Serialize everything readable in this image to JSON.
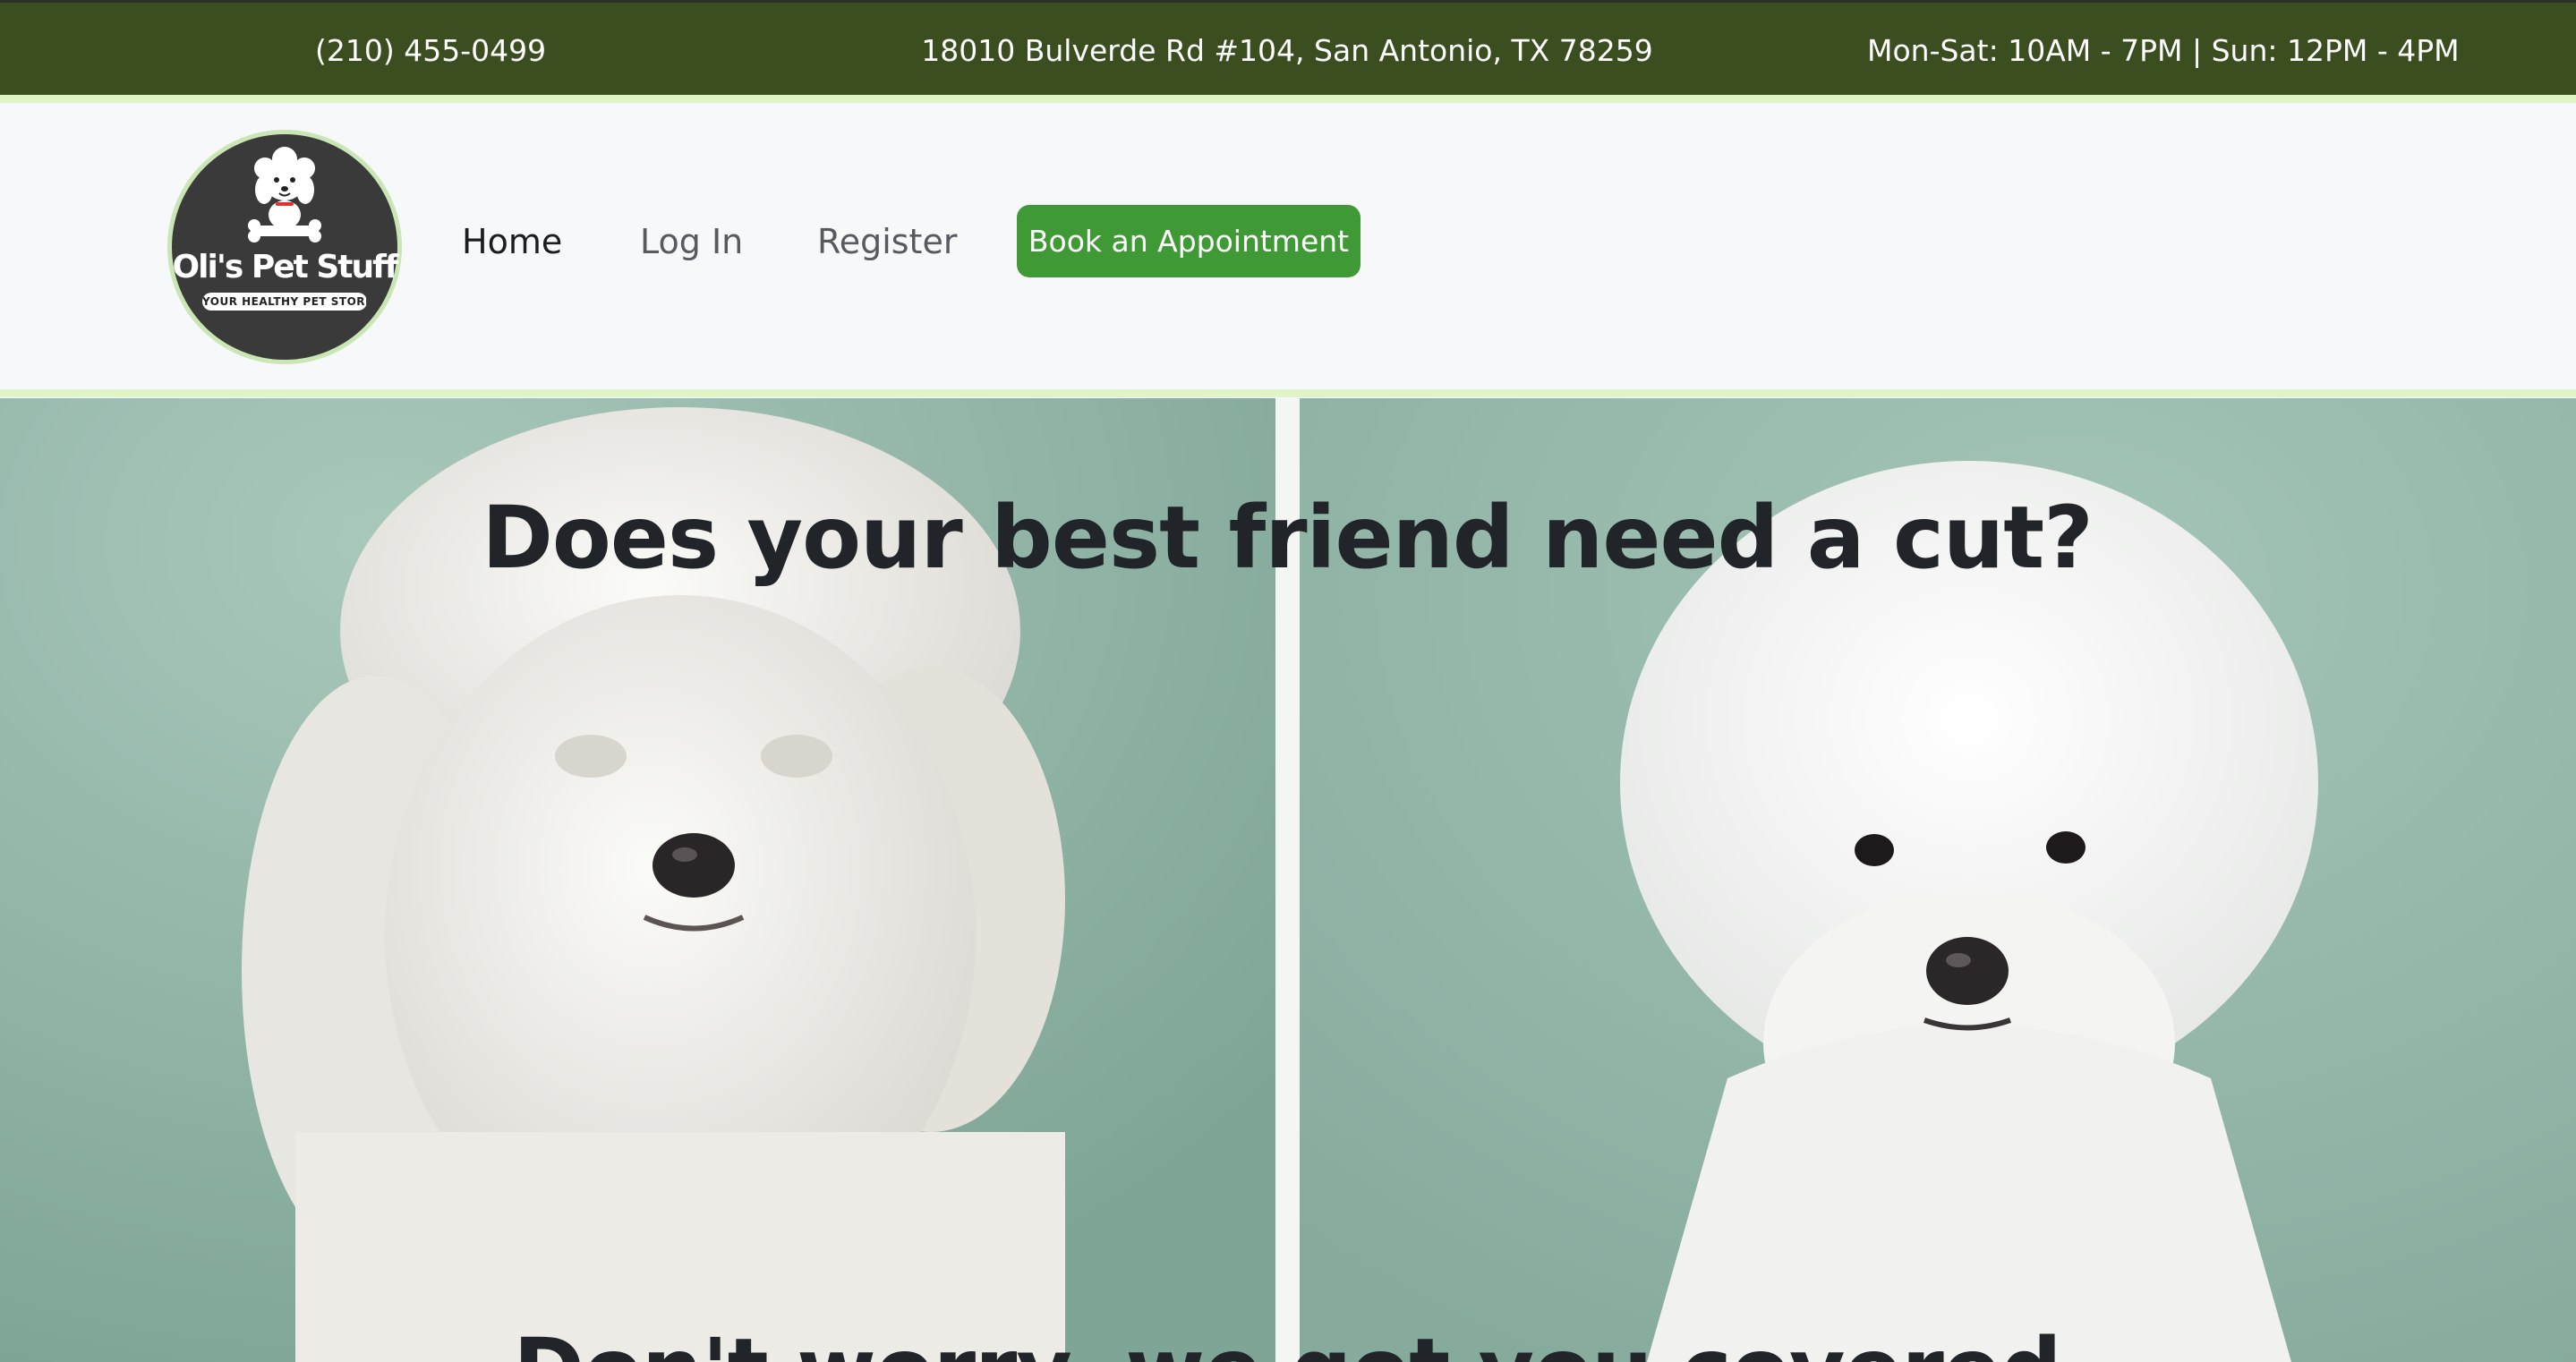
{
  "topbar": {
    "phone": "(210) 455-0499",
    "address": "18010 Bulverde Rd #104, San Antonio, TX 78259",
    "hours": "Mon-Sat: 10AM - 7PM | Sun: 12PM - 4PM"
  },
  "logo": {
    "name": "Oli's Pet Stuff",
    "tagline": "YOUR HEALTHY PET STORE"
  },
  "nav": {
    "home": "Home",
    "login": "Log In",
    "register": "Register",
    "book": "Book an Appointment"
  },
  "hero": {
    "title": "Does your best friend need a cut?",
    "subtitle": "Don't worry, we got you covered"
  },
  "colors": {
    "topbar_bg": "#3a4e20",
    "accent_stripe": "#dff5c6",
    "button_bg": "#3f9a36",
    "hero_bg": "#8fb3a6"
  }
}
